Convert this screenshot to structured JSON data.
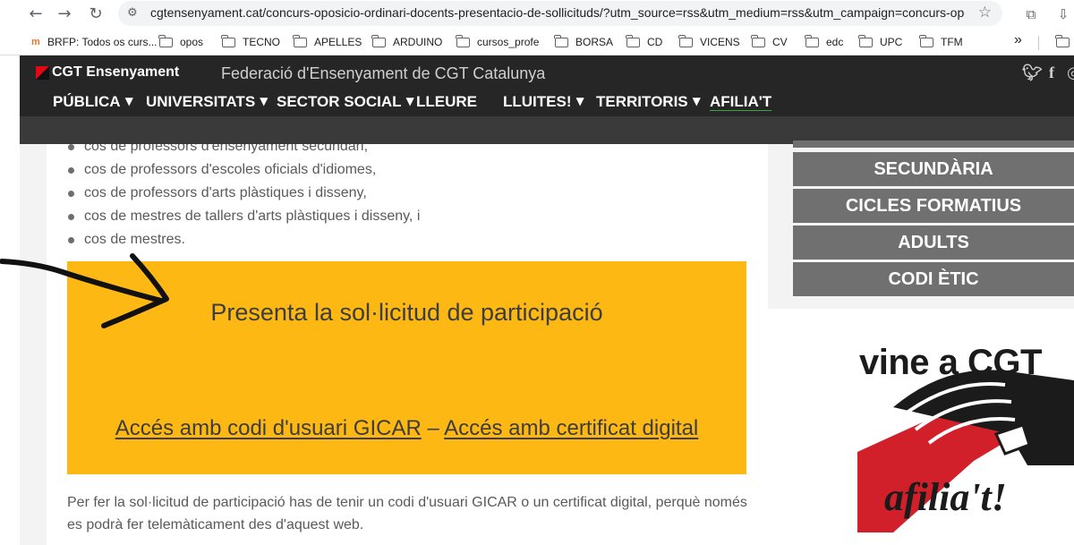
{
  "browser": {
    "url": "cgtensenyament.cat/concurs-oposicio-ordinari-docents-presentacio-de-sollicituds/?utm_source=rss&utm_medium=rss&utm_campaign=concurs-oposici..."
  },
  "bookmarks": [
    {
      "label": "BRFP: Todos os curs...",
      "icon": "favicon-icon"
    },
    {
      "label": "opos",
      "icon": "folder-icon"
    },
    {
      "label": "TECNO",
      "icon": "folder-icon"
    },
    {
      "label": "APELLES",
      "icon": "folder-icon"
    },
    {
      "label": "ARDUINO",
      "icon": "folder-icon"
    },
    {
      "label": "cursos_profe",
      "icon": "folder-icon"
    },
    {
      "label": "BORSA",
      "icon": "folder-icon"
    },
    {
      "label": "CD",
      "icon": "folder-icon"
    },
    {
      "label": "VICENS",
      "icon": "folder-icon"
    },
    {
      "label": "CV",
      "icon": "folder-icon"
    },
    {
      "label": "edc",
      "icon": "folder-icon"
    },
    {
      "label": "UPC",
      "icon": "folder-icon"
    },
    {
      "label": "TFM",
      "icon": "folder-icon"
    }
  ],
  "bookmarks_more": "»",
  "site": {
    "brand": "CGT Ensenyament",
    "federation_title": "Federació d'Ensenyament de CGT Catalunya",
    "menu": [
      {
        "label": "PÚBLICA",
        "dropdown": true
      },
      {
        "label": "UNIVERSITATS",
        "dropdown": true
      },
      {
        "label": "SECTOR SOCIAL",
        "dropdown": true
      },
      {
        "label": "LLEURE",
        "dropdown": false
      },
      {
        "label": "LLUITES!",
        "dropdown": true
      },
      {
        "label": "TERRITORIS",
        "dropdown": true
      },
      {
        "label": "AFILIA'T",
        "dropdown": false
      }
    ]
  },
  "content": {
    "bullets": [
      "cos de professors d'ensenyament secundari,",
      "cos de professors d'escoles oficials d'idiomes,",
      "cos de professors d'arts plàstiques i disseny,",
      "cos de mestres de tallers d'arts plàstiques i disseny, i",
      "cos de mestres."
    ],
    "box_title": "Presenta la sol·licitud de participació",
    "link_gicar": "Accés amb codi d'usuari GICAR",
    "link_separator": " – ",
    "link_cert": "Accés amb certificat digital",
    "paragraph": "Per fer la sol·licitud de participació has de tenir un codi d'usuari GICAR o un certificat digital, perquè només es podrà fer telemàticament des d'aquest web."
  },
  "sidebar": {
    "buttons": [
      "SECUNDÀRIA",
      "CICLES FORMATIUS",
      "ADULTS",
      "CODI ÈTIC"
    ],
    "promo_text": "vine a CGT",
    "promo_script": "afilia't!"
  },
  "colors": {
    "yellow": "#fdb813",
    "dark_bar": "#262626",
    "sidebar_button": "#707070",
    "cgt_red": "#e30613"
  }
}
